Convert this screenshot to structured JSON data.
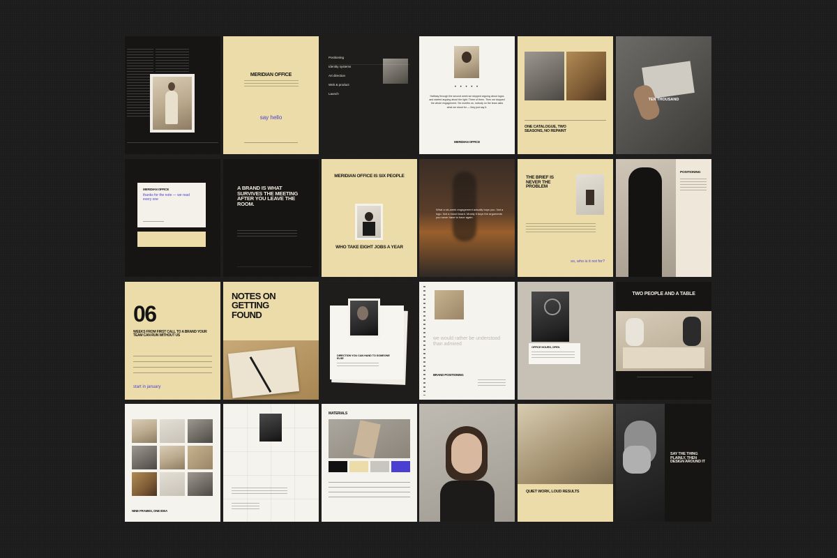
{
  "tiles": {
    "r1c2": {
      "title": "MERIDIAN OFFICE",
      "cta": "say hello"
    },
    "r1c3": {
      "menu": [
        "Positioning",
        "Identity systems",
        "Art direction",
        "Web & product",
        "Launch"
      ]
    },
    "r1c4": {
      "quote": "Halfway through the second week we stopped arguing about logos and started arguing about the light. Three of them. Then we stopped the whole engagement. Six months on, nobody on the team asks what we stood for — they just say it.",
      "footer": "MERIDIAN OFFICE"
    },
    "r1c5": {
      "headline": "ONE CATALOGUE, TWO SEASONS, NO REPAINT"
    },
    "r1c6": {
      "caption": "TEN THOUSAND"
    },
    "r2c1": {
      "title": "MERIDIAN OFFICE",
      "text": "thanks for the note — we read every one"
    },
    "r2c2": {
      "headline": "A BRAND IS WHAT SURVIVES THE MEETING AFTER YOU LEAVE THE ROOM."
    },
    "r2c3": {
      "headline": "MERIDIAN OFFICE IS SIX PEOPLE",
      "subhead": "WHO TAKE EIGHT JOBS A YEAR"
    },
    "r2c4": {
      "quote": "What a six-week engagement actually buys you. Not a logo. Not a mood board. Mostly it buys the arguments you never have to have again."
    },
    "r2c5": {
      "headline": "THE BRIEF IS NEVER THE PROBLEM",
      "cta": "so, who is it not for?"
    },
    "r2c6": {
      "title": "POSITIONING"
    },
    "r3c1": {
      "number": "06",
      "headline": "WEEKS FROM FIRST CALL TO A BRAND YOUR TEAM CAN RUN WITHOUT US",
      "cta": "start in january"
    },
    "r3c2": {
      "headline": "NOTES ON GETTING FOUND"
    },
    "r3c3": {
      "caption": "DIRECTION YOU CAN HAND TO SOMEONE ELSE"
    },
    "r3c4": {
      "quote": "we would rather be understood than admired",
      "title": "BRAND POSITIONING"
    },
    "r3c5": {
      "caption": "OFFICE HOURS, OPEN"
    },
    "r3c6": {
      "headline": "TWO PEOPLE AND A TABLE"
    },
    "r4c1": {
      "caption": "NINE FRAMES, ONE IDEA"
    },
    "r4c3": {
      "title": "MATERIALS",
      "swatches": [
        "#111111",
        "#ebdca9",
        "#c9c6c0",
        "#4a3fd0"
      ]
    },
    "r4c5": {
      "headline": "QUIET WORK, LOUD RESULTS"
    },
    "r4c6": {
      "headline": "SAY THE THING PLAINLY, THEN DESIGN AROUND IT"
    }
  },
  "colors": {
    "background": "#1c1c1c",
    "cream": "#ebdca9",
    "accent_blue": "#4a3fd0",
    "dark": "#161514"
  }
}
